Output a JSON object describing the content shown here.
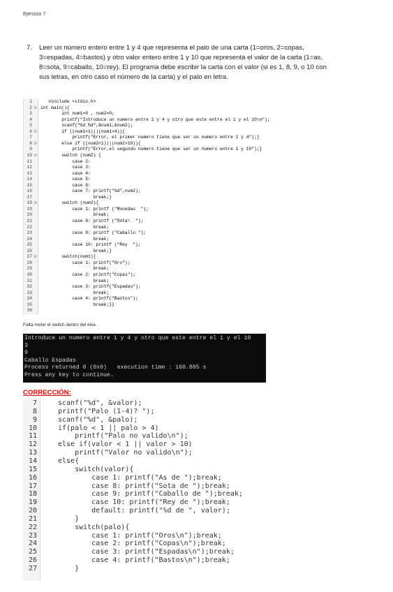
{
  "header": {
    "title": "Ejercicio 7"
  },
  "task": {
    "number": "7.",
    "text": "Leer un número entero entre 1 y 4 que representa el palo de una carta (1=oros, 2=copas, 3=espadas, 4=bastos) y otro valor entero entre 1 y 10 que representa el valor de la carta (1=as, 8=sota, 9=caballo, 10=rey). El programa debe escribir la carta con el valor (si es 1, 8, 9, o 10 con sus letras, en otro caso el número de la carta) y el palo en letra."
  },
  "code1": {
    "lines": [
      {
        "n": "1",
        "t": "   #include <stdio.h>"
      },
      {
        "n": "2",
        "t": "int main(){"
      },
      {
        "n": "3",
        "t": "        int num1=0 , num2=0;"
      },
      {
        "n": "4",
        "t": "        printf(\"Introduce un numero entre 1 y 4 y otro que este entre el 1 y el 10\\n\");"
      },
      {
        "n": "5",
        "t": "        scanf(\"%d %d\",&num1,&num2);"
      },
      {
        "n": "6",
        "t": "        if ((num1<1)||(num1>4)){"
      },
      {
        "n": "7",
        "t": "            printf(\"Error, el primer numero tiene que ser un numero entre 1 y 4\");}"
      },
      {
        "n": "8",
        "t": "        else if ((num2<1)||(num2>10)){"
      },
      {
        "n": "9",
        "t": "            printf(\"Error,el segundo numero tiene que ser un numero entre 1 y 10\");}"
      },
      {
        "n": "10",
        "t": "        switch (num2) {"
      },
      {
        "n": "11",
        "t": "            case 2:"
      },
      {
        "n": "12",
        "t": "            case 3:"
      },
      {
        "n": "13",
        "t": "            case 4:"
      },
      {
        "n": "14",
        "t": "            case 5:"
      },
      {
        "n": "15",
        "t": "            case 6:"
      },
      {
        "n": "16",
        "t": "            case 7: printf(\"%d\",num2);"
      },
      {
        "n": "17",
        "t": "                    break;}"
      },
      {
        "n": "18",
        "t": "        switch (num2){"
      },
      {
        "n": "19",
        "t": "            case 1: printf (\"Monedas  \");"
      },
      {
        "n": "20",
        "t": "                    break;"
      },
      {
        "n": "21",
        "t": "            case 8: printf (\"Sota\\  \");"
      },
      {
        "n": "22",
        "t": "                    break;"
      },
      {
        "n": "23",
        "t": "            case 9: printf (\"Caballo \");"
      },
      {
        "n": "24",
        "t": "                    break;"
      },
      {
        "n": "25",
        "t": "            case 10: printf (\"Rey  \");"
      },
      {
        "n": "26",
        "t": "                    break;}"
      },
      {
        "n": "27",
        "t": "        switch(num1){"
      },
      {
        "n": "28",
        "t": "            case 1: printf(\"Oro\");"
      },
      {
        "n": "29",
        "t": "                    break;"
      },
      {
        "n": "30",
        "t": "            case 2: printf(\"Copas\");"
      },
      {
        "n": "31",
        "t": "                    break;"
      },
      {
        "n": "32",
        "t": "            case 3: printf(\"Espadas\");"
      },
      {
        "n": "33",
        "t": "                    break;"
      },
      {
        "n": "34",
        "t": "            case 4: printf(\"Bastos\");"
      },
      {
        "n": "35",
        "t": "                    break;}}"
      },
      {
        "n": "36",
        "t": ""
      }
    ]
  },
  "note": "Falta meter el switch dentro del else.",
  "console": {
    "lines": [
      "Introduce un numero entre 1 y 4 y otro que este entre el 1 y el 10",
      "3",
      "9",
      "Caballo Espadas",
      "Process returned 0 (0x0)   execution time : 160.885 s",
      "Press any key to continue."
    ]
  },
  "correction_label": "CORRECCIÓN:",
  "code2": {
    "lines": [
      {
        "n": "7",
        "t": "scanf(\"%d\", &valor);"
      },
      {
        "n": "8",
        "t": "printf(\"Palo (1-4)? \");"
      },
      {
        "n": "9",
        "t": "scanf(\"%d\", &palo);"
      },
      {
        "n": "10",
        "t": "if(palo < 1 || palo > 4)"
      },
      {
        "n": "11",
        "t": "    printf(\"Palo no valido\\n\");"
      },
      {
        "n": "12",
        "t": "else if(valor < 1 || valor > 10)"
      },
      {
        "n": "13",
        "t": "    printf(\"Valor no valido\\n\");"
      },
      {
        "n": "14",
        "t": "else{"
      },
      {
        "n": "15",
        "t": "    switch(valor){"
      },
      {
        "n": "16",
        "t": "        case 1: printf(\"As de \");break;"
      },
      {
        "n": "17",
        "t": "        case 8: printf(\"Sota de \");break;"
      },
      {
        "n": "18",
        "t": "        case 9: printf(\"Caballo de \");break;"
      },
      {
        "n": "19",
        "t": "        case 10: printf(\"Rey de \");break;"
      },
      {
        "n": "20",
        "t": "        default: printf(\"%d de \", valor);"
      },
      {
        "n": "21",
        "t": "    }"
      },
      {
        "n": "22",
        "t": "    switch(palo){"
      },
      {
        "n": "23",
        "t": "        case 1: printf(\"Oros\\n\");break;"
      },
      {
        "n": "24",
        "t": "        case 2: printf(\"Copas\\n\");break;"
      },
      {
        "n": "25",
        "t": "        case 3: printf(\"Espadas\\n\");break;"
      },
      {
        "n": "26",
        "t": "        case 4: printf(\"Bastos\\n\");break;"
      },
      {
        "n": "27",
        "t": "    }"
      }
    ]
  }
}
